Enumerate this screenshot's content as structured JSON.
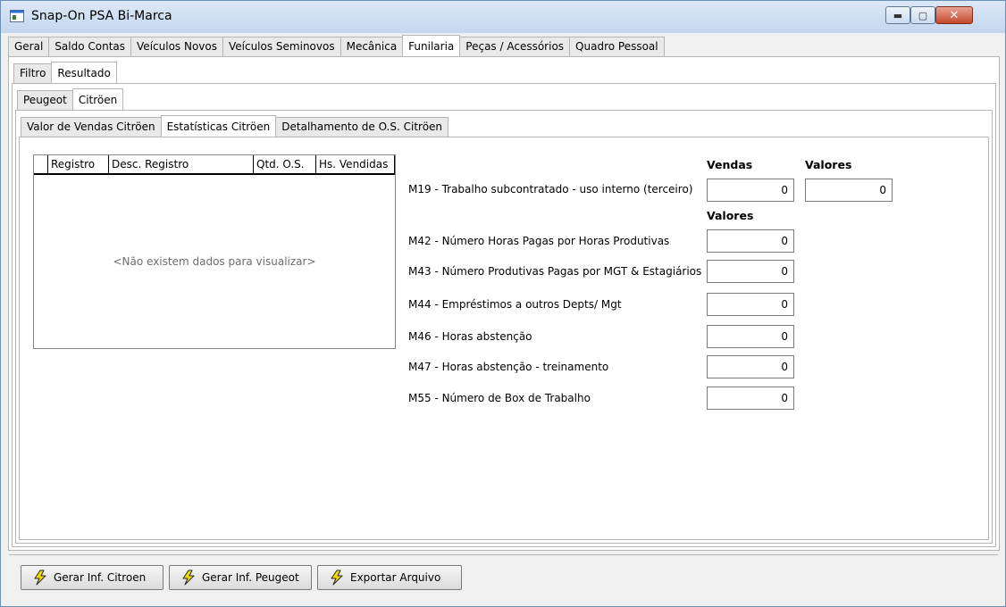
{
  "window": {
    "title": "Snap-On PSA Bi-Marca",
    "min_glyph": "▬",
    "max_glyph": "▢",
    "close_glyph": "✕"
  },
  "main_tabs": [
    {
      "label": "Geral"
    },
    {
      "label": "Saldo Contas"
    },
    {
      "label": "Veículos Novos"
    },
    {
      "label": "Veículos Seminovos"
    },
    {
      "label": "Mecânica"
    },
    {
      "label": "Funilaria",
      "active": true
    },
    {
      "label": "Peças / Acessórios"
    },
    {
      "label": "Quadro Pessoal"
    }
  ],
  "sub_tabs": [
    {
      "label": "Filtro"
    },
    {
      "label": "Resultado",
      "active": true
    }
  ],
  "brand_tabs": [
    {
      "label": "Peugeot"
    },
    {
      "label": "Citröen",
      "active": true
    }
  ],
  "detail_tabs": [
    {
      "label": "Valor de Vendas Citröen"
    },
    {
      "label": "Estatísticas Citröen",
      "active": true
    },
    {
      "label": "Detalhamento de O.S. Citröen"
    }
  ],
  "grid": {
    "columns": [
      "Registro",
      "Desc. Registro",
      "Qtd. O.S.",
      "Hs. Vendidas"
    ],
    "empty_text": "<Não existem dados para visualizar>"
  },
  "stats": {
    "header_vendas": "Vendas",
    "header_valores": "Valores",
    "header_valores2": "Valores",
    "m19": {
      "label": "M19 - Trabalho subcontratado - uso interno (terceiro)",
      "vendas": "0",
      "valores": "0"
    },
    "rows": [
      {
        "label": "M42 - Número Horas Pagas por Horas Produtivas",
        "value": "0"
      },
      {
        "label": "M43 - Número Produtivas Pagas por MGT & Estagiários",
        "value": "0"
      },
      {
        "label": "M44 - Empréstimos a outros Depts/ Mgt",
        "value": "0"
      },
      {
        "label": "M46 - Horas abstenção",
        "value": "0"
      },
      {
        "label": "M47 - Horas abstenção - treinamento",
        "value": "0"
      },
      {
        "label": "M55 - Número de Box de Trabalho",
        "value": "0"
      }
    ]
  },
  "buttons": {
    "gerar_citroen": "Gerar Inf. Citroen",
    "gerar_peugeot": "Gerar Inf. Peugeot",
    "exportar": "Exportar Arquivo"
  },
  "colors": {
    "bolt_fill": "#f5d800",
    "bolt_stroke": "#2a2a2a"
  }
}
